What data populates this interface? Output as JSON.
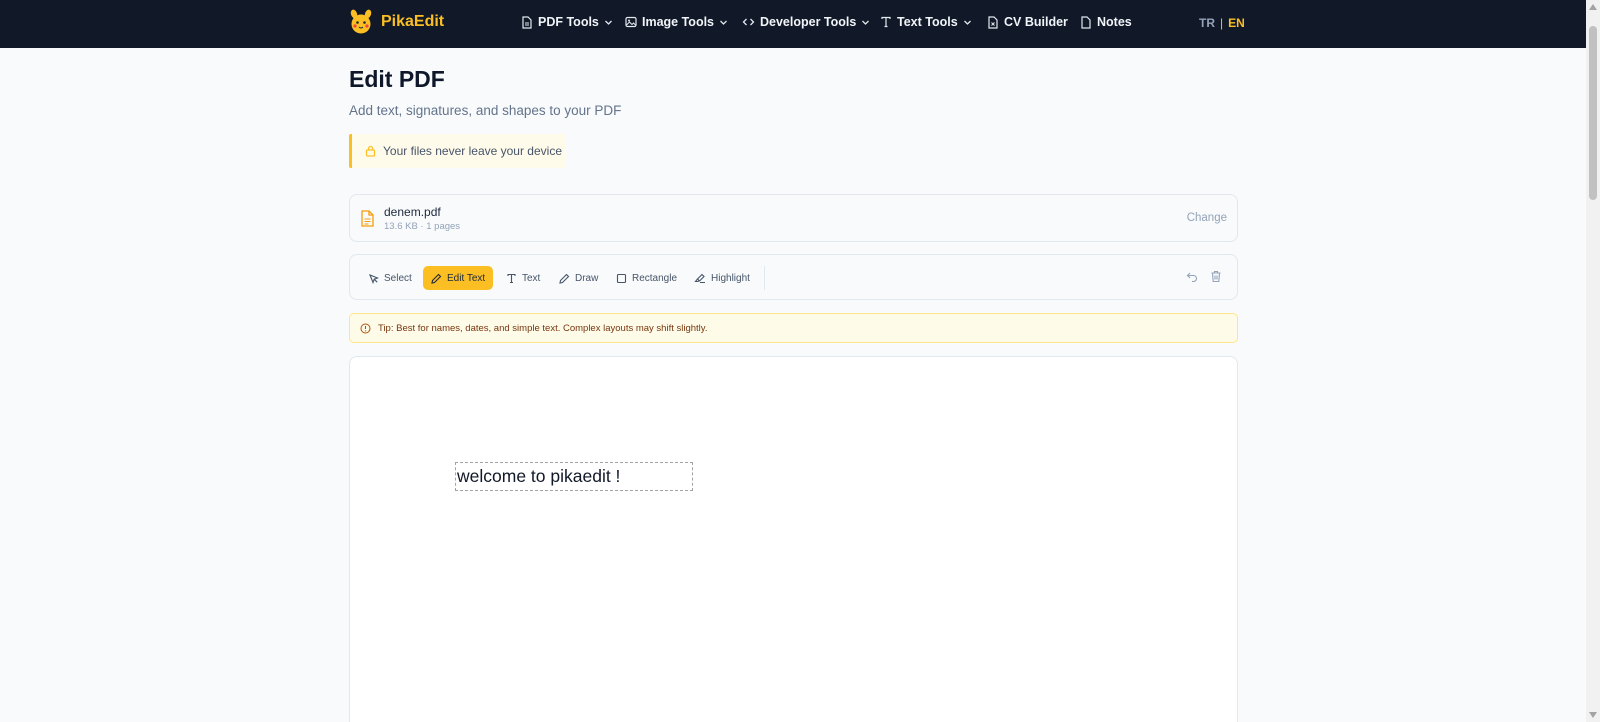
{
  "brand": {
    "name": "PikaEdit"
  },
  "nav": {
    "items": [
      {
        "label": "PDF Tools",
        "icon": "file-icon",
        "has_dropdown": true
      },
      {
        "label": "Image Tools",
        "icon": "image-icon",
        "has_dropdown": true
      },
      {
        "label": "Developer Tools",
        "icon": "code-icon",
        "has_dropdown": true
      },
      {
        "label": "Text Tools",
        "icon": "type-icon",
        "has_dropdown": true
      },
      {
        "label": "CV Builder",
        "icon": "file-pdf-icon",
        "has_dropdown": false
      },
      {
        "label": "Notes",
        "icon": "note-icon",
        "has_dropdown": false
      }
    ],
    "lang": {
      "tr": "TR",
      "separator": "|",
      "en": "EN",
      "active": "EN"
    }
  },
  "page": {
    "title": "Edit PDF",
    "subtitle": "Add text, signatures, and shapes to your PDF",
    "privacy_note": "Your files never leave your device"
  },
  "file": {
    "name": "denem.pdf",
    "meta": "13.6 KB · 1 pages",
    "change_label": "Change"
  },
  "toolbar": {
    "tools": [
      {
        "label": "Select",
        "icon": "cursor-icon",
        "active": false
      },
      {
        "label": "Edit Text",
        "icon": "pencil-icon",
        "active": true
      },
      {
        "label": "Text",
        "icon": "type-icon",
        "active": false
      },
      {
        "label": "Draw",
        "icon": "pen-icon",
        "active": false
      },
      {
        "label": "Rectangle",
        "icon": "square-icon",
        "active": false
      },
      {
        "label": "Highlight",
        "icon": "highlighter-icon",
        "active": false
      }
    ],
    "actions": [
      "undo-icon",
      "trash-icon"
    ]
  },
  "tip": {
    "text": "Tip: Best for names, dates, and simple text. Complex layouts may shift slightly."
  },
  "document": {
    "text_content": "welcome to pikaedit !"
  },
  "colors": {
    "nav_bg": "#111827",
    "accent": "#fbbf24",
    "page_bg": "#f8fafc",
    "tip_bg": "#fefce8",
    "tip_text": "#78350f"
  }
}
